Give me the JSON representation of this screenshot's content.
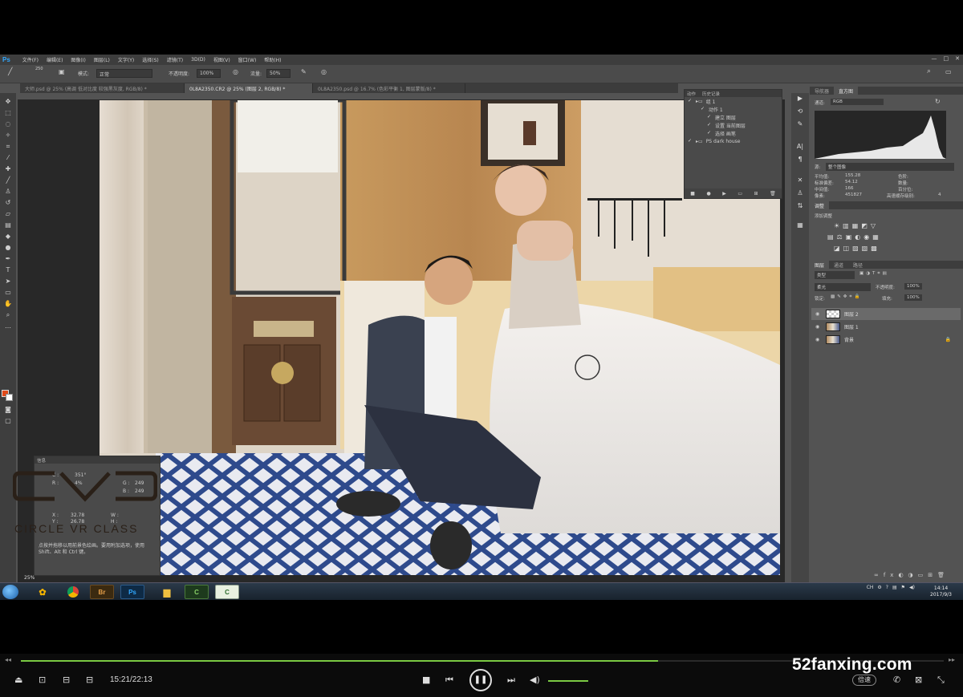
{
  "ps": {
    "logo": "Ps",
    "menu": [
      "文件(F)",
      "编辑(E)",
      "图像(I)",
      "图层(L)",
      "文字(Y)",
      "选择(S)",
      "滤镜(T)",
      "3D(D)",
      "视图(V)",
      "窗口(W)",
      "帮助(H)"
    ],
    "options": {
      "brush_size": "250",
      "mode_label": "模式:",
      "mode_value": "正常",
      "opacity_label": "不透明度:",
      "opacity_value": "100%",
      "flow_label": "流量:",
      "flow_value": "50%"
    },
    "tabs": [
      "大师.psd @ 25% (高调 低对比度 较强黑灰度, RGB/8) *",
      "0L8A2350.CR2 @ 25% (图层 2, RGB/8) *",
      "0L8A2350.psd @ 16.7% (色彩平衡 1, 图层蒙版/8) *"
    ],
    "zoom": "25%"
  },
  "actions_panel": {
    "tabs": [
      "动作",
      "历史记录"
    ],
    "rows": [
      "组 1",
      "动作 1",
      "建立 图层",
      "设置 当前图层",
      "选择 画笔",
      "PS dark house"
    ]
  },
  "info_panel": {
    "title": "信息",
    "values": [
      "C :",
      "351°",
      "R :",
      "4%",
      "G :",
      "249",
      "B :",
      "249",
      "X :",
      "32.78",
      "Y :",
      "26.78",
      "W :",
      "H :"
    ],
    "help": "点按并拖移以用前景色绘画。要用附加选项，使用 Shift、Alt 和 Ctrl 键。"
  },
  "watermark": {
    "logo": "CVC",
    "text": "CIRCLE VR CLASS"
  },
  "right_panels": {
    "top_tabs": [
      "导航器",
      "直方图"
    ],
    "channel_label": "通道:",
    "channel_value": "RGB",
    "source_label": "源:",
    "source_value": "整个图像",
    "stats": {
      "mean_label": "平均值:",
      "mean": "155.28",
      "std_label": "标准偏差:",
      "std": "54.12",
      "median_label": "中间值:",
      "median": "166",
      "pixels_label": "像素:",
      "pixels": "451827",
      "level_label": "色阶:",
      "count_label": "数量:",
      "percentile_label": "百分位:",
      "cache_label": "高速缓存级别:",
      "cache": "4"
    },
    "adjust_tabs": [
      "调整"
    ],
    "adjust_add": "添加调整",
    "layers_tabs": [
      "图层",
      "通道",
      "路径"
    ],
    "kind_label": "类型",
    "blend_value": "柔光",
    "opacity_label": "不透明度:",
    "opacity_value": "100%",
    "lock_label": "锁定:",
    "fill_label": "填充:",
    "fill_value": "100%",
    "layers": [
      {
        "name": "图层 2",
        "selected": true
      },
      {
        "name": "图层 1",
        "selected": false
      },
      {
        "name": "背景",
        "selected": false
      }
    ]
  },
  "taskbar": {
    "apps": [
      "Br",
      "Ps",
      "",
      "C",
      "C"
    ],
    "clock_time": "14:14",
    "clock_date": "2017/9/3",
    "lang": "CH"
  },
  "player": {
    "time": "15:21/22:13",
    "progress": 0.69,
    "brand": "52fanxing.com",
    "speed": "倍速"
  },
  "colors": {
    "ps_blue": "#31a8ff",
    "foreground": "#e04a1a",
    "accent_green": "#7ac943"
  }
}
